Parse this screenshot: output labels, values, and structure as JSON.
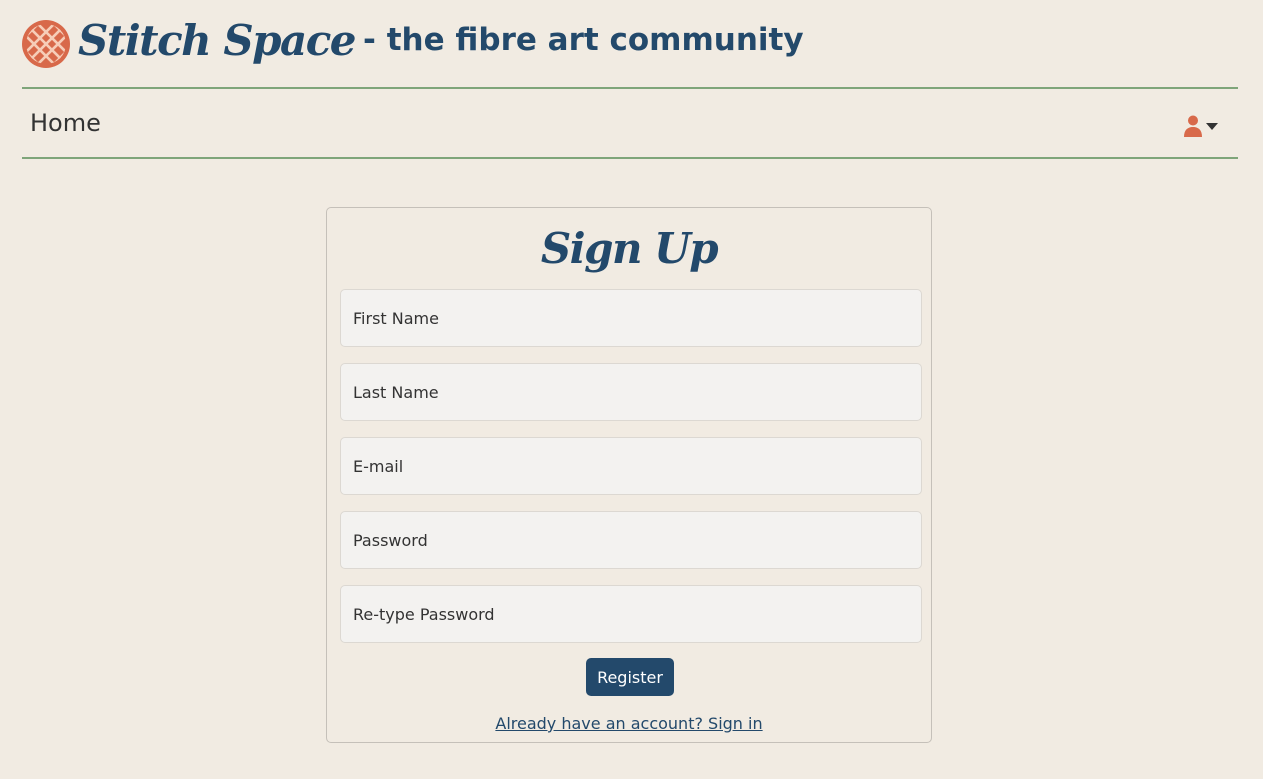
{
  "header": {
    "logo_icon": "cross-stitch-logo-icon",
    "brand_name": "Stitch Space",
    "tagline": "- the fibre art community"
  },
  "navbar": {
    "home_label": "Home",
    "user_icon": "user-icon",
    "dropdown_icon": "caret-down-icon"
  },
  "signup": {
    "title": "Sign Up",
    "first_name_placeholder": "First Name",
    "last_name_placeholder": "Last Name",
    "email_placeholder": "E-mail",
    "password_placeholder": "Password",
    "retype_password_placeholder": "Re-type Password",
    "register_label": "Register",
    "signin_link": "Already have an account? Sign in"
  },
  "colors": {
    "background": "#f1ebe2",
    "brand_blue": "#23496b",
    "accent_orange": "#d8694a",
    "divider_green": "#7fa57a",
    "input_background": "#f3f2f0"
  }
}
